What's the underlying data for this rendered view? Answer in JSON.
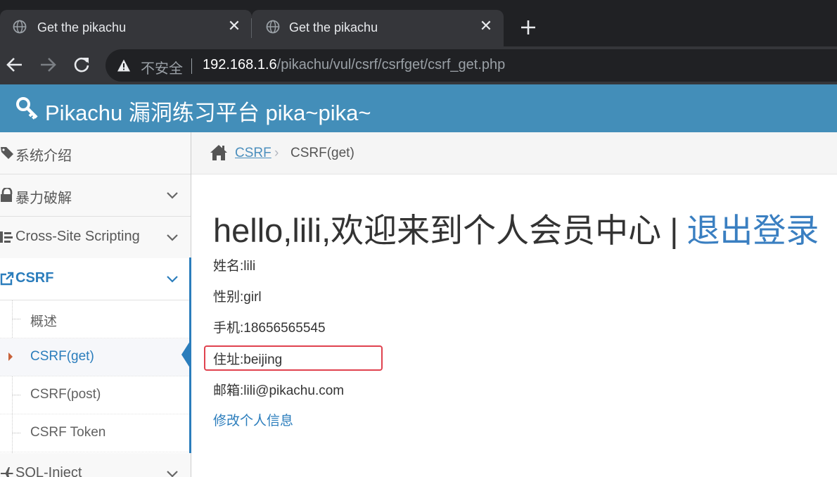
{
  "browser": {
    "tabs": [
      {
        "title": "Get the pikachu",
        "icon": "globe-icon"
      },
      {
        "title": "Get the pikachu",
        "icon": "globe-icon"
      }
    ],
    "close_glyph": "✕",
    "address": {
      "security_label": "不安全",
      "host": "192.168.1.6",
      "path": "/pikachu/vul/csrf/csrfget/csrf_get.php"
    }
  },
  "header": {
    "brand": "Pikachu 漏洞练习平台 pika~pika~",
    "icon": "key-icon"
  },
  "sidebar": {
    "items": [
      {
        "label": "系统介绍",
        "icon": "tags-icon",
        "expandable": false
      },
      {
        "label": "暴力破解",
        "icon": "lock-icon",
        "expandable": true
      },
      {
        "label": "Cross-Site Scripting",
        "icon": "list-icon",
        "expandable": true
      },
      {
        "label": "CSRF",
        "icon": "share-square-icon",
        "expandable": true,
        "active": true
      },
      {
        "label": "SQL-Inject",
        "icon": "plane-icon",
        "expandable": true
      }
    ],
    "submenu": [
      {
        "label": "概述"
      },
      {
        "label": "CSRF(get)",
        "active": true
      },
      {
        "label": "CSRF(post)"
      },
      {
        "label": "CSRF Token"
      }
    ]
  },
  "breadcrumb": {
    "parent": "CSRF",
    "separator": "›",
    "current": "CSRF(get)"
  },
  "main": {
    "welcome": "hello,lili,欢迎来到个人会员中心",
    "divider": "|",
    "logout": "退出登录",
    "fields": {
      "name": "姓名:lili",
      "gender": "性别:girl",
      "phone": "手机:18656565545",
      "address": "住址:beijing",
      "email": "邮箱:lili@pikachu.com"
    },
    "edit_link": "修改个人信息"
  },
  "colors": {
    "header_bg": "#438eb9",
    "accent": "#2b7dbc",
    "highlight": "#e0424f"
  }
}
